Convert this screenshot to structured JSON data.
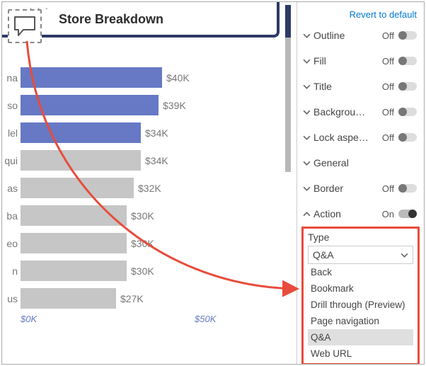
{
  "chart": {
    "title": "Store Breakdown",
    "ellipsis": "· · ·"
  },
  "chart_data": {
    "type": "bar",
    "orientation": "horizontal",
    "categories": [
      "na",
      "so",
      "lel",
      "qui",
      "as",
      "ba",
      "eo",
      "n",
      "us"
    ],
    "values": [
      40,
      39,
      34,
      34,
      32,
      30,
      30,
      30,
      27
    ],
    "value_labels": [
      "$40K",
      "$39K",
      "$34K",
      "$34K",
      "$32K",
      "$30K",
      "$30K",
      "$30K",
      "$27K"
    ],
    "highlight": [
      true,
      true,
      true,
      false,
      false,
      false,
      false,
      false,
      false
    ],
    "title": "Store Breakdown",
    "xlabel": "",
    "ylabel": "",
    "xlim": [
      0,
      50
    ],
    "xticks": [
      "$0K",
      "$50K"
    ]
  },
  "format_pane": {
    "revert": "Revert to default",
    "rows": [
      {
        "label": "Outline",
        "state": "Off",
        "expanded": false,
        "toggle": true
      },
      {
        "label": "Fill",
        "state": "Off",
        "expanded": false,
        "toggle": true
      },
      {
        "label": "Title",
        "state": "Off",
        "expanded": false,
        "toggle": true
      },
      {
        "label": "Backgrou…",
        "state": "Off",
        "expanded": false,
        "toggle": true
      },
      {
        "label": "Lock aspe…",
        "state": "Off",
        "expanded": false,
        "toggle": true
      },
      {
        "label": "General",
        "state": "",
        "expanded": false,
        "toggle": false
      },
      {
        "label": "Border",
        "state": "Off",
        "expanded": false,
        "toggle": true
      },
      {
        "label": "Action",
        "state": "On",
        "expanded": true,
        "toggle": true
      }
    ],
    "dropdown": {
      "label": "Type",
      "selected": "Q&A",
      "options": [
        "Back",
        "Bookmark",
        "Drill through (Preview)",
        "Page navigation",
        "Q&A",
        "Web URL"
      ]
    }
  }
}
